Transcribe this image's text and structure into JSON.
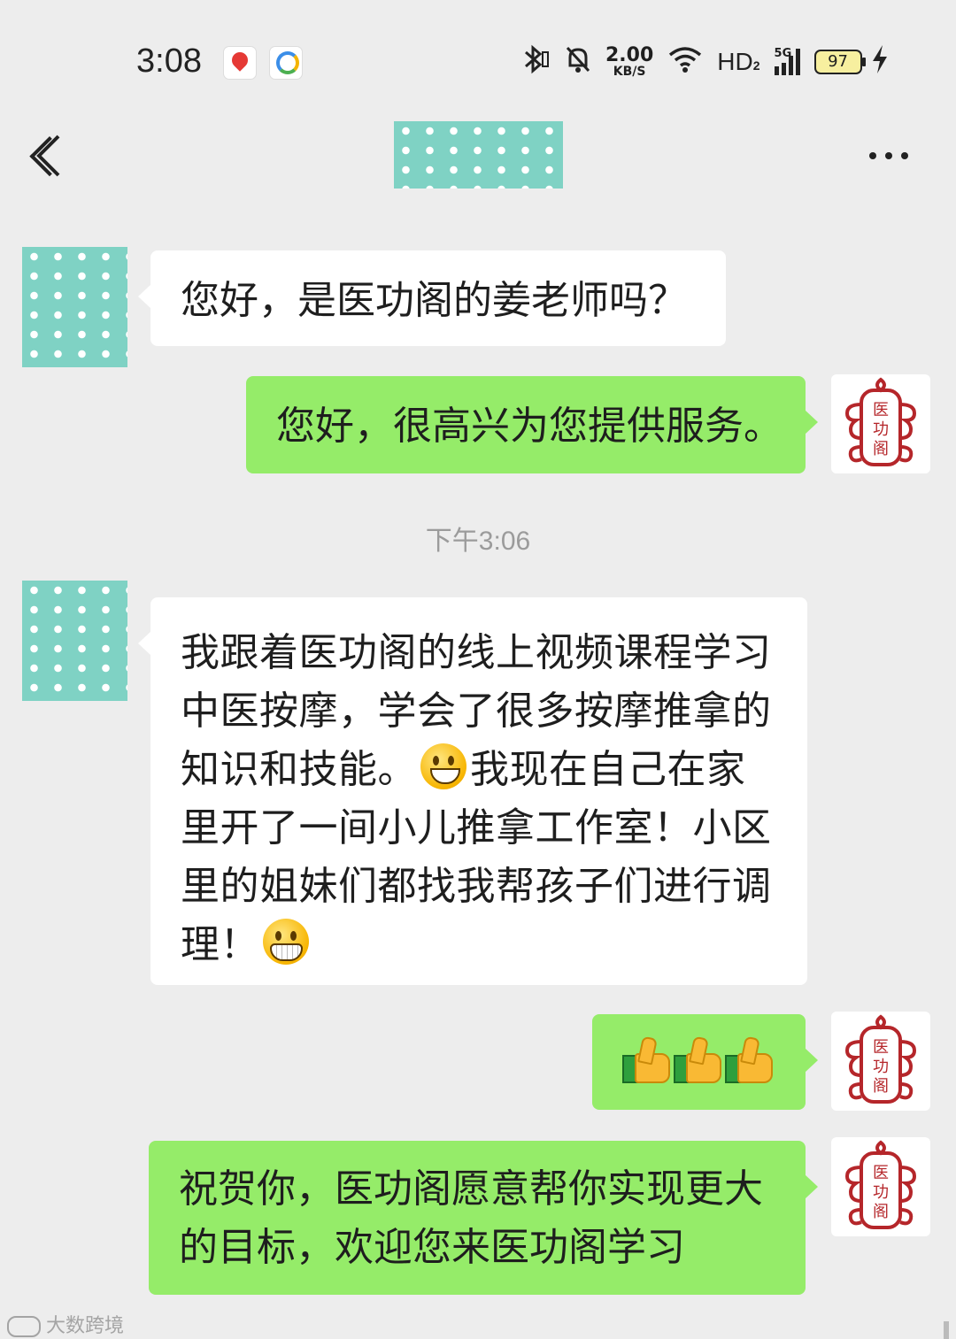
{
  "status_bar": {
    "time": "3:08",
    "app_icons": [
      "baidu-map-icon",
      "app-notification-icon"
    ],
    "network_speed_value": "2.00",
    "network_speed_unit": "KB/S",
    "hd_label": "HD",
    "hd_sub": "2",
    "signal_label": "5G",
    "battery_level": "97",
    "bluetooth_icon": "bluetooth-icon",
    "mute_icon": "bell-muted-icon",
    "wifi_icon": "wifi-icon",
    "charging_icon": "lightning-icon"
  },
  "nav": {
    "back_icon": "chevron-left-icon",
    "more_icon": "more-dots-icon"
  },
  "chat": {
    "messages": [
      {
        "side": "left",
        "text": "您好，是医功阁的姜老师吗？"
      },
      {
        "side": "right",
        "text": "您好，很高兴为您提供服务。"
      },
      {
        "side": "left",
        "text_parts": [
          "我跟着医功阁的线上视频课程学习中医按摩，学会了很多按摩推拿的知识和技能。",
          "我现在自己在家里开了一间小儿推拿工作室！小区里的姐妹们都找我帮孩子们进行调理！"
        ],
        "emoji": [
          "grinning-face-emoji",
          "big-grin-face-emoji"
        ]
      },
      {
        "side": "right",
        "emoji": [
          "thumbs-up-emoji",
          "thumbs-up-emoji",
          "thumbs-up-emoji"
        ]
      },
      {
        "side": "right",
        "text": "祝贺你，医功阁愿意帮你实现更大的目标，欢迎您来医功阁学习"
      }
    ],
    "time_divider": "下午3:06",
    "seal_avatar_text": [
      "医",
      "功",
      "阁"
    ]
  },
  "watermark": "大数跨境",
  "colors": {
    "background": "#ededed",
    "bubble_green": "#95ec69",
    "bubble_white": "#ffffff",
    "seal_red": "#b5262a",
    "redacted_teal": "#7fd2c4"
  }
}
